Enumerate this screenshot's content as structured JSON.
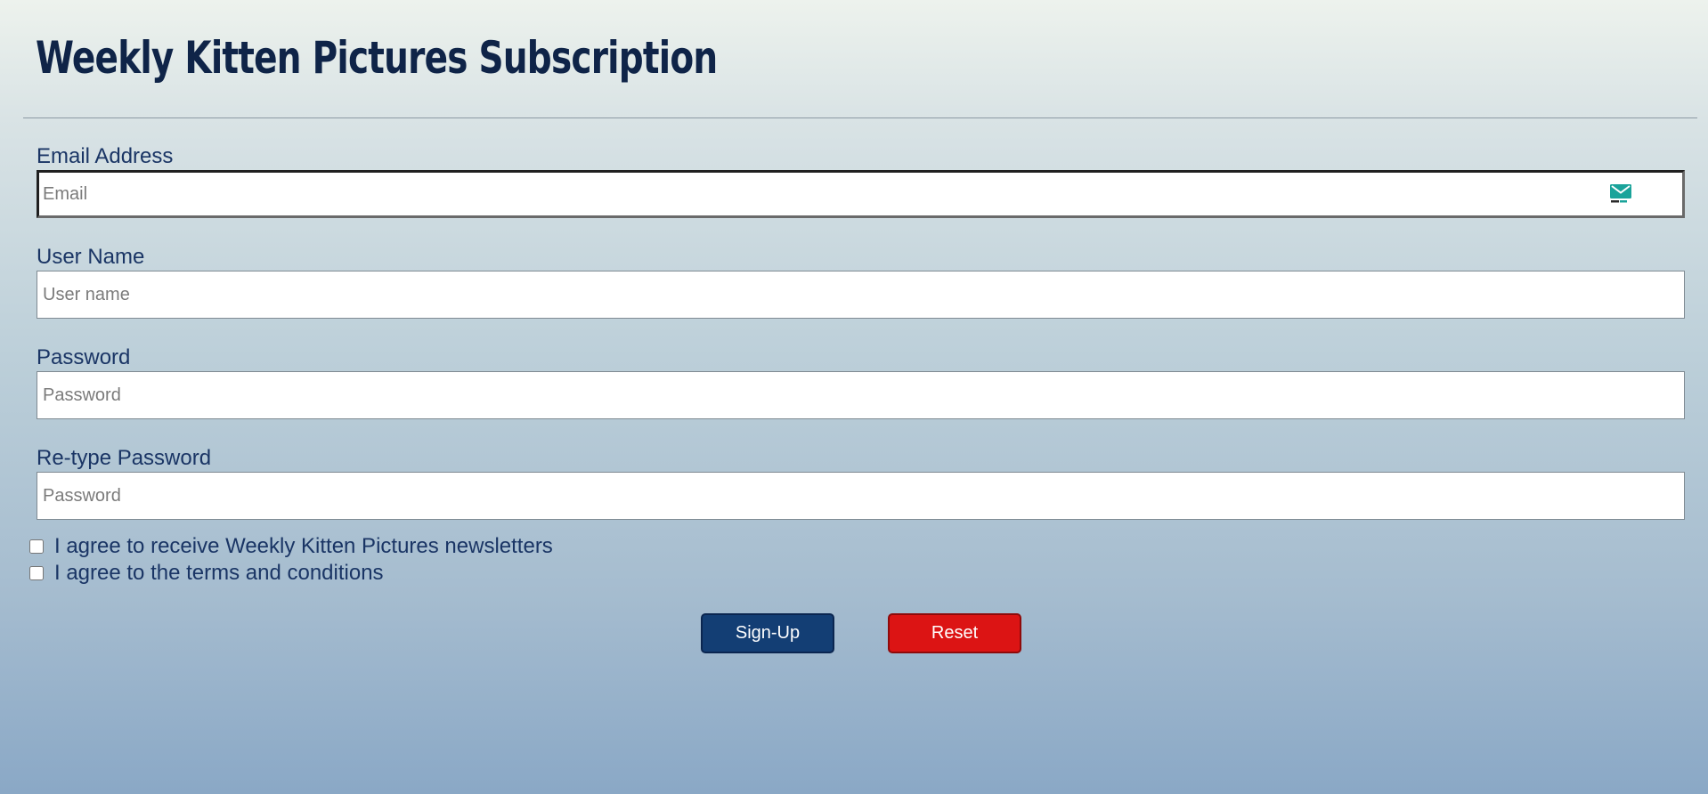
{
  "header": {
    "title": "Weekly Kitten Pictures Subscription"
  },
  "form": {
    "email": {
      "label": "Email Address",
      "placeholder": "Email",
      "value": "",
      "icon": "mail-icon"
    },
    "username": {
      "label": "User Name",
      "placeholder": "User name",
      "value": ""
    },
    "password": {
      "label": "Password",
      "placeholder": "Password",
      "value": ""
    },
    "retype_password": {
      "label": "Re-type Password",
      "placeholder": "Password",
      "value": ""
    },
    "checkboxes": [
      {
        "label": "I agree to receive Weekly Kitten Pictures newsletters",
        "checked": false
      },
      {
        "label": "I agree to the terms and conditions",
        "checked": false
      }
    ],
    "buttons": {
      "signup_label": "Sign-Up",
      "reset_label": "Reset"
    }
  },
  "colors": {
    "title": "#0f2448",
    "label": "#1a3565",
    "signup_button": "#133e74",
    "reset_button": "#dc1414",
    "mail_icon": "#1aa39a"
  }
}
